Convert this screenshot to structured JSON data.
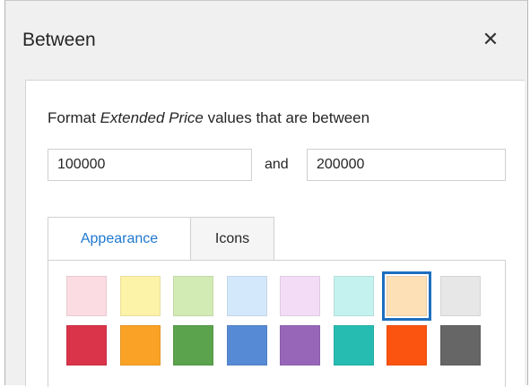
{
  "dialog": {
    "title": "Between",
    "close_icon": "close-icon"
  },
  "rule": {
    "prefix": "Format ",
    "field": "Extended Price",
    "suffix": " values that are between",
    "from_value": "100000",
    "and_label": "and",
    "to_value": "200000"
  },
  "tabs": [
    {
      "label": "Appearance",
      "active": true
    },
    {
      "label": "Icons",
      "active": false
    }
  ],
  "swatches": {
    "row1": [
      {
        "color": "#fcdce3"
      },
      {
        "color": "#fdf3a8"
      },
      {
        "color": "#d2ebb4"
      },
      {
        "color": "#d4e8fb"
      },
      {
        "color": "#f2dcf6"
      },
      {
        "color": "#c4f2ee"
      },
      {
        "color": "#fde0b6",
        "selected": true
      },
      {
        "color": "#e7e7e7"
      }
    ],
    "row2": [
      {
        "color": "#d9344a"
      },
      {
        "color": "#f9a225"
      },
      {
        "color": "#5ba34c"
      },
      {
        "color": "#578ad5"
      },
      {
        "color": "#9766b9"
      },
      {
        "color": "#27bcb2"
      },
      {
        "color": "#fb5410"
      },
      {
        "color": "#666666"
      }
    ]
  }
}
